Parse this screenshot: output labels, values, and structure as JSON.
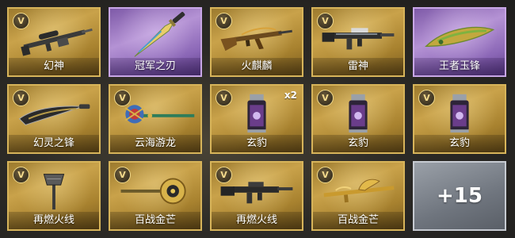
{
  "badge_letter": "V",
  "colors": {
    "gold": "#c9a24a",
    "purple": "#b492d4",
    "gray": "#7a8089"
  },
  "items": [
    {
      "name": "幻神",
      "rarity": "gold",
      "icon": "sniper-rifle-icon"
    },
    {
      "name": "冠军之刃",
      "rarity": "purple",
      "icon": "knife-icon"
    },
    {
      "name": "火麒麟",
      "rarity": "gold",
      "icon": "ak-rifle-icon"
    },
    {
      "name": "雷神",
      "rarity": "gold",
      "icon": "assault-rifle-icon"
    },
    {
      "name": "王者玉锋",
      "rarity": "purple",
      "icon": "jade-blade-icon"
    },
    {
      "name": "幻灵之锋",
      "rarity": "gold",
      "icon": "curved-blade-icon"
    },
    {
      "name": "云海游龙",
      "rarity": "gold",
      "icon": "dragon-spear-icon"
    },
    {
      "name": "玄豹",
      "rarity": "gold",
      "icon": "grenade-canister-icon",
      "quantity": "x2"
    },
    {
      "name": "玄豹",
      "rarity": "gold",
      "icon": "grenade-canister-icon"
    },
    {
      "name": "玄豹",
      "rarity": "gold",
      "icon": "grenade-canister-icon"
    },
    {
      "name": "再燃火线",
      "rarity": "gold",
      "icon": "axe-icon"
    },
    {
      "name": "百战金芒",
      "rarity": "gold",
      "icon": "golden-mace-icon"
    },
    {
      "name": "再燃火线",
      "rarity": "gold",
      "icon": "m4-rifle-icon"
    },
    {
      "name": "百战金芒",
      "rarity": "gold",
      "icon": "golden-dragon-rifle-icon"
    }
  ],
  "more": {
    "label": "+15"
  }
}
